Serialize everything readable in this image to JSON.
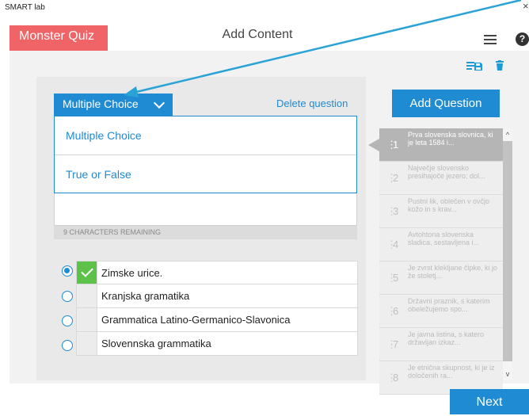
{
  "window": {
    "title": "SMART lab",
    "close": "×"
  },
  "header": {
    "app_name": "Monster Quiz",
    "title": "Add Content",
    "help": "?"
  },
  "toolbar": {
    "icons": [
      "add-list-icon",
      "save-icon",
      "trash-icon"
    ],
    "add_list_glyph": "≡+",
    "save_glyph": "💾",
    "trash_glyph": "🗑"
  },
  "editor": {
    "question_type": "Multiple Choice",
    "delete_label": "Delete question",
    "type_options": [
      "Multiple Choice",
      "True or False"
    ],
    "chars_remaining": "9 CHARACTERS REMAINING",
    "answers": [
      {
        "text": "Zimske urice.",
        "selected": true,
        "correct": true
      },
      {
        "text": "Kranjska gramatika",
        "selected": false,
        "correct": false
      },
      {
        "text": "Grammatica Latino-Germanico-Slavonica",
        "selected": false,
        "correct": false
      },
      {
        "text": "Slovennska grammatika",
        "selected": false,
        "correct": false
      }
    ]
  },
  "sidebar": {
    "add_label": "Add Question",
    "questions": [
      {
        "num": "1",
        "text": "Prva slovenska slovnica, ki je leta 1584 i...",
        "active": true
      },
      {
        "num": "2",
        "text": "Največje slovensko presihajoče jezero; dol...",
        "active": false
      },
      {
        "num": "3",
        "text": "Pustni lik, oblečen v ovčjo kožo in s krav...",
        "active": false
      },
      {
        "num": "4",
        "text": "Avtohtona slovenska sladica, sestavljena i...",
        "active": false
      },
      {
        "num": "5",
        "text": "Je zvrst klekljane čipke, ki jo že stoletj...",
        "active": false
      },
      {
        "num": "6",
        "text": "Državni praznik, s katerim obeležujemo spo...",
        "active": false
      },
      {
        "num": "7",
        "text": "Je javna listina, s katero državljan izkaz...",
        "active": false
      },
      {
        "num": "8",
        "text": "Je etnična skupnost, ki je iz določenih ra...",
        "active": false
      }
    ]
  },
  "footer": {
    "next_label": "Next"
  },
  "colors": {
    "accent": "#1e8bd2",
    "brand": "#f06366",
    "correct": "#5cc24a",
    "annotation_arrow": "#29a3d6"
  }
}
